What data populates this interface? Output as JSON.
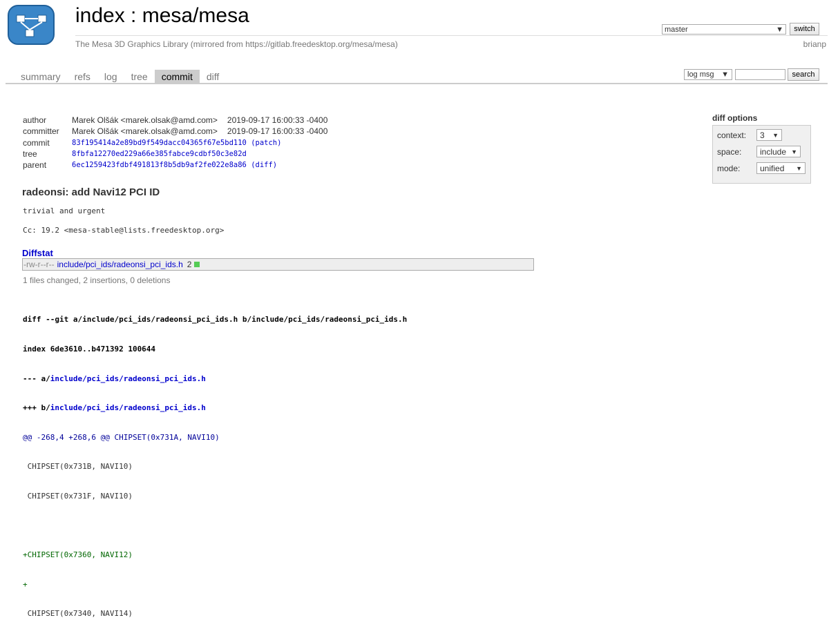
{
  "header": {
    "title": "index : mesa/mesa",
    "description": "The Mesa 3D Graphics Library (mirrored from https://gitlab.freedesktop.org/mesa/mesa)",
    "owner": "brianp",
    "branch": "master",
    "switch_label": "switch"
  },
  "tabs": [
    {
      "label": "summary"
    },
    {
      "label": "refs"
    },
    {
      "label": "log"
    },
    {
      "label": "tree"
    },
    {
      "label": "commit",
      "active": true
    },
    {
      "label": "diff"
    }
  ],
  "search": {
    "mode": "log msg",
    "query": "",
    "button_label": "search"
  },
  "commit": {
    "author_label": "author",
    "author": "Marek Olšák <marek.olsak@amd.com>",
    "author_date": "2019-09-17 16:00:33 -0400",
    "committer_label": "committer",
    "committer": "Marek Olšák <marek.olsak@amd.com>",
    "committer_date": "2019-09-17 16:00:33 -0400",
    "commit_label": "commit",
    "commit_hash": "83f195414a2e89bd9f549dacc04365f67e5bd110",
    "patch_link": "(patch)",
    "tree_label": "tree",
    "tree_hash": "8fbfa12270ed229a66e385fabce9cdbf50c3e82d",
    "parent_label": "parent",
    "parent_hash": "6ec1259423fdbf491813f8b5db9af2fe022e8a86",
    "diff_link": "(diff)",
    "subject": "radeonsi: add Navi12 PCI ID",
    "body_line1": "trivial and urgent",
    "body_line2": "Cc: 19.2 <mesa-stable@lists.freedesktop.org>"
  },
  "diff_options": {
    "heading": "diff options",
    "context_label": "context:",
    "context_value": "3",
    "space_label": "space:",
    "space_value": "include",
    "mode_label": "mode:",
    "mode_value": "unified"
  },
  "diffstat": {
    "heading": "Diffstat",
    "mode": "-rw-r--r--",
    "file": "include/pci_ids/radeonsi_pci_ids.h",
    "changes": "2",
    "summary": "1 files changed, 2 insertions, 0 deletions"
  },
  "diff": {
    "header_line": "diff --git a/include/pci_ids/radeonsi_pci_ids.h b/include/pci_ids/radeonsi_pci_ids.h",
    "index_line": "index 6de3610..b471392 100644",
    "old_prefix": "--- a/",
    "new_prefix": "+++ b/",
    "file": "include/pci_ids/radeonsi_pci_ids.h",
    "hunk": "@@ -268,4 +268,6 @@ CHIPSET(0x731A, NAVI10)",
    "lines": [
      {
        "text": " CHIPSET(0x731B, NAVI10)",
        "type": "ctx"
      },
      {
        "text": " CHIPSET(0x731F, NAVI10)",
        "type": "ctx"
      },
      {
        "text": " ",
        "type": "ctx"
      },
      {
        "text": "+CHIPSET(0x7360, NAVI12)",
        "type": "add"
      },
      {
        "text": "+",
        "type": "add"
      },
      {
        "text": " CHIPSET(0x7340, NAVI14)",
        "type": "ctx"
      }
    ]
  },
  "colors": {
    "link": "#0000cc",
    "added": "#006600",
    "hunk": "#000099",
    "diffstat_bar": "#55cc55"
  }
}
